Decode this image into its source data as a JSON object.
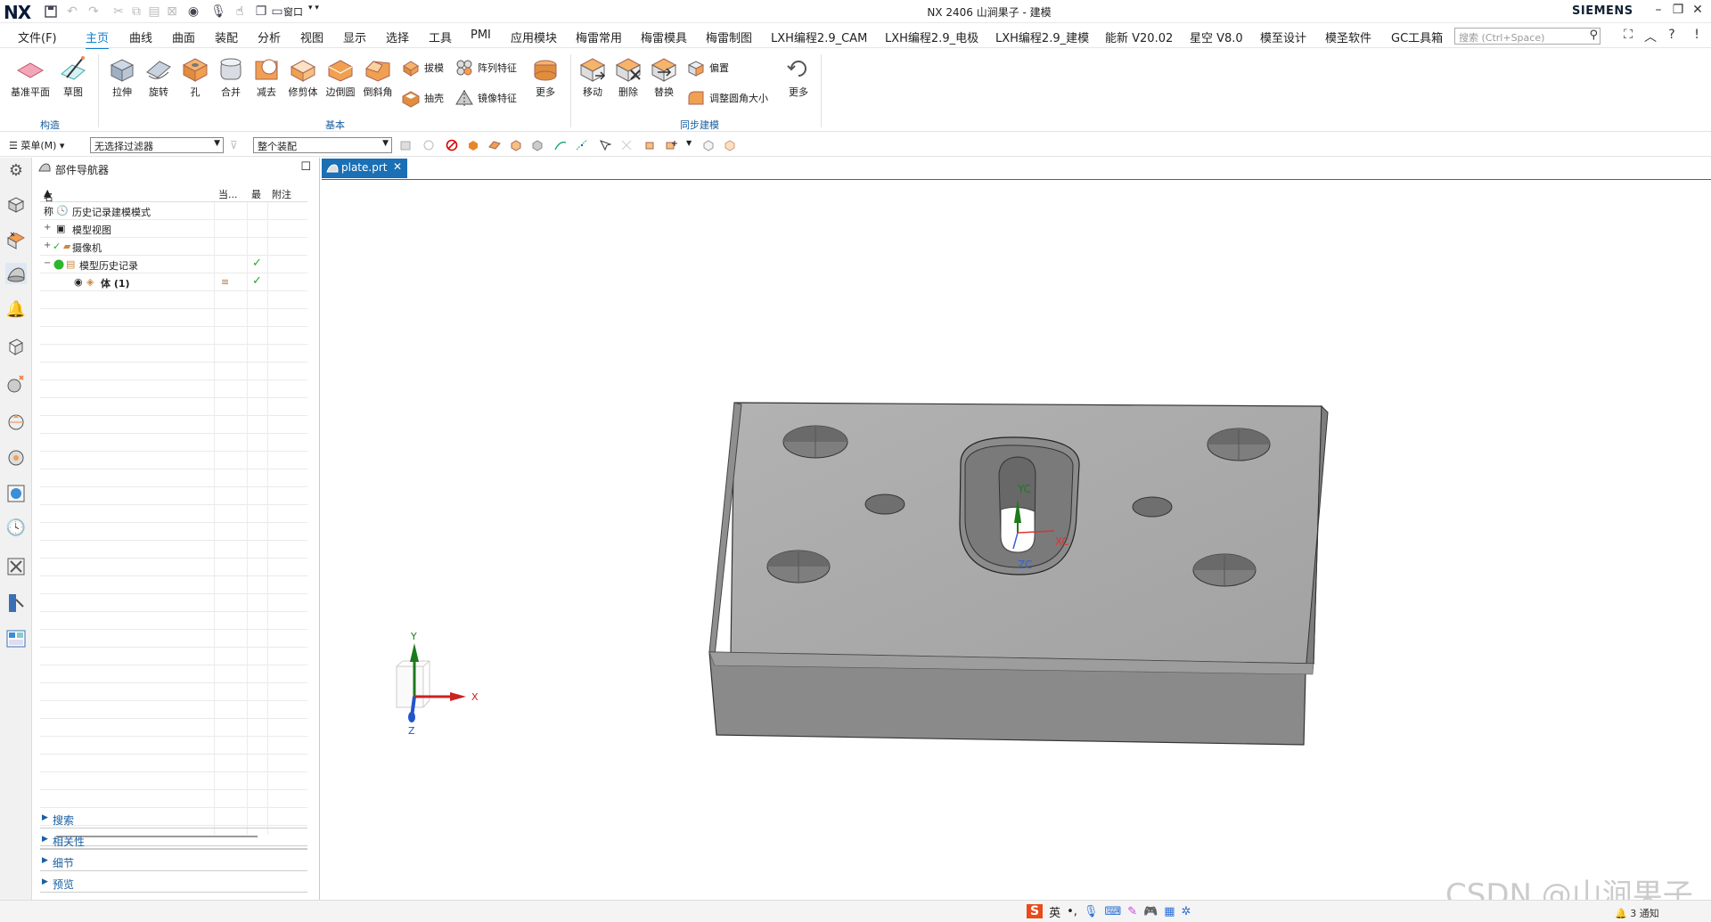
{
  "titlebar": {
    "logo": "NX",
    "title": "NX 2406 山涧果子 - 建模",
    "brand": "SIEMENS",
    "window_label": "窗口"
  },
  "menubar": {
    "file": "文件(F)",
    "tabs": [
      "主页",
      "曲线",
      "曲面",
      "装配",
      "分析",
      "视图",
      "显示",
      "选择",
      "工具",
      "PMI",
      "应用模块",
      "梅雷常用",
      "梅雷模具",
      "梅雷制图",
      "LXH编程2.9_CAM",
      "LXH编程2.9_电极",
      "LXH编程2.9_建模",
      "能新 V20.02",
      "星空 V8.0",
      "模至设计",
      "模圣软件",
      "GC工具箱"
    ],
    "active_tab": "主页",
    "search_placeholder": "搜索 (Ctrl+Space)"
  },
  "ribbon": {
    "construct": {
      "label": "构造",
      "items": [
        "基准平面",
        "草图"
      ]
    },
    "basic": {
      "label": "基本",
      "items": [
        "拉伸",
        "旋转",
        "孔",
        "合并",
        "减去",
        "修剪体",
        "边倒圆",
        "倒斜角"
      ],
      "small": [
        "拔模",
        "阵列特征",
        "抽壳",
        "镜像特征"
      ],
      "more": "更多"
    },
    "sync": {
      "label": "同步建模",
      "items": [
        "移动",
        "删除",
        "替换"
      ],
      "small": [
        "偏置",
        "调整圆角大小"
      ],
      "more": "更多"
    }
  },
  "selbar": {
    "menu": "菜单(M)",
    "filter": "无选择过滤器",
    "scope": "整个装配"
  },
  "navigator": {
    "title": "部件导航器",
    "columns": [
      "名称",
      "当...",
      "最",
      "附注"
    ],
    "rows": [
      {
        "label": "历史记录建模模式"
      },
      {
        "label": "模型视图"
      },
      {
        "label": "摄像机"
      },
      {
        "label": "模型历史记录"
      },
      {
        "label": "体 (1)"
      }
    ],
    "sections": [
      "搜索",
      "相关性",
      "细节",
      "预览"
    ]
  },
  "document": {
    "tab": "plate.prt"
  },
  "viewport": {
    "wcs": {
      "x": "XC",
      "y": "YC",
      "z": "ZC"
    },
    "triad": {
      "x": "X",
      "y": "Y",
      "z": "Z"
    }
  },
  "status": {
    "ime": "英",
    "notify": "3 通知"
  },
  "watermark": "CSDN @山涧果子"
}
